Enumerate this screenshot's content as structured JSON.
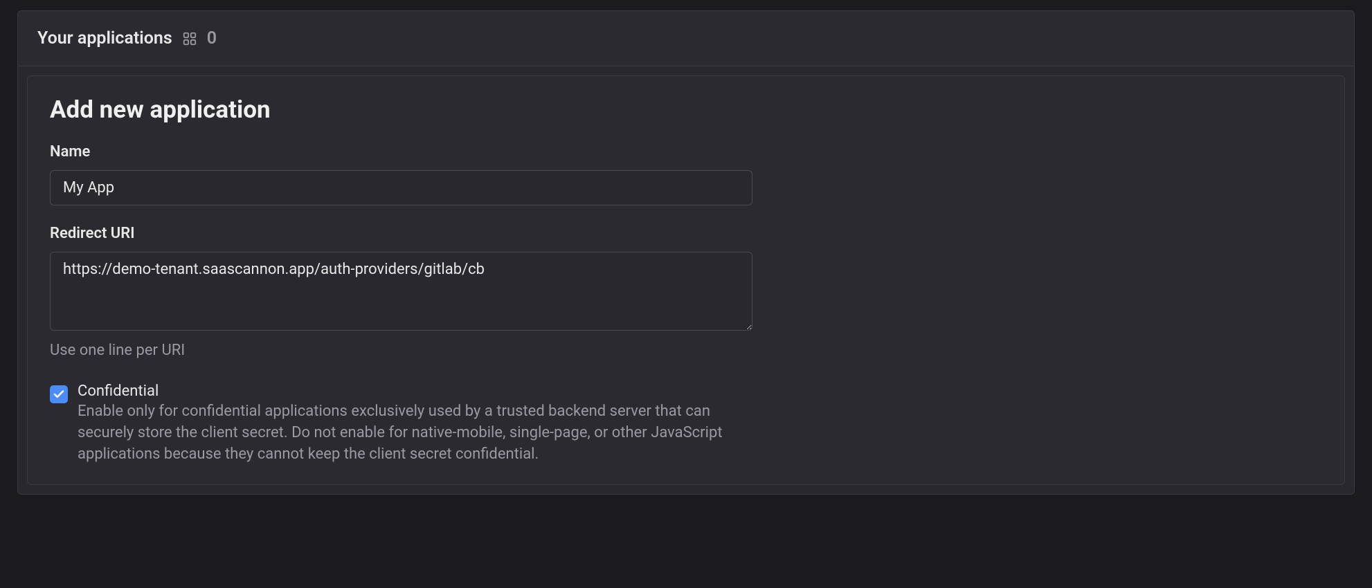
{
  "header": {
    "title": "Your applications",
    "count": "0"
  },
  "form": {
    "title": "Add new application",
    "name": {
      "label": "Name",
      "value": "My App"
    },
    "redirect_uri": {
      "label": "Redirect URI",
      "value": "https://demo-tenant.saascannon.app/auth-providers/gitlab/cb",
      "help": "Use one line per URI"
    },
    "confidential": {
      "label": "Confidential",
      "checked": true,
      "description": "Enable only for confidential applications exclusively used by a trusted backend server that can securely store the client secret. Do not enable for native-mobile, single-page, or other JavaScript applications because they cannot keep the client secret confidential."
    }
  }
}
